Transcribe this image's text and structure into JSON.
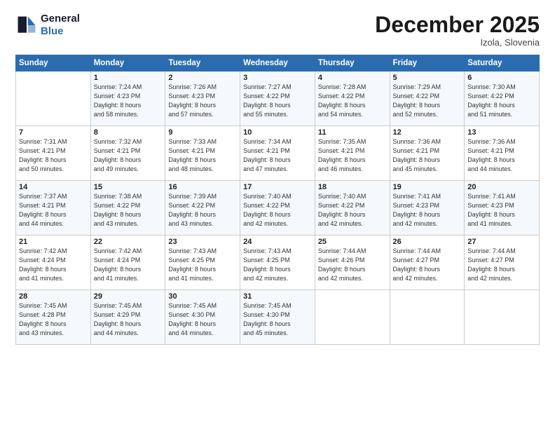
{
  "header": {
    "logo_line1": "General",
    "logo_line2": "Blue",
    "month": "December 2025",
    "location": "Izola, Slovenia"
  },
  "days_of_week": [
    "Sunday",
    "Monday",
    "Tuesday",
    "Wednesday",
    "Thursday",
    "Friday",
    "Saturday"
  ],
  "weeks": [
    [
      {
        "day": "",
        "content": ""
      },
      {
        "day": "1",
        "content": "Sunrise: 7:24 AM\nSunset: 4:23 PM\nDaylight: 8 hours\nand 58 minutes."
      },
      {
        "day": "2",
        "content": "Sunrise: 7:26 AM\nSunset: 4:23 PM\nDaylight: 8 hours\nand 57 minutes."
      },
      {
        "day": "3",
        "content": "Sunrise: 7:27 AM\nSunset: 4:22 PM\nDaylight: 8 hours\nand 55 minutes."
      },
      {
        "day": "4",
        "content": "Sunrise: 7:28 AM\nSunset: 4:22 PM\nDaylight: 8 hours\nand 54 minutes."
      },
      {
        "day": "5",
        "content": "Sunrise: 7:29 AM\nSunset: 4:22 PM\nDaylight: 8 hours\nand 52 minutes."
      },
      {
        "day": "6",
        "content": "Sunrise: 7:30 AM\nSunset: 4:22 PM\nDaylight: 8 hours\nand 51 minutes."
      }
    ],
    [
      {
        "day": "7",
        "content": "Sunrise: 7:31 AM\nSunset: 4:21 PM\nDaylight: 8 hours\nand 50 minutes."
      },
      {
        "day": "8",
        "content": "Sunrise: 7:32 AM\nSunset: 4:21 PM\nDaylight: 8 hours\nand 49 minutes."
      },
      {
        "day": "9",
        "content": "Sunrise: 7:33 AM\nSunset: 4:21 PM\nDaylight: 8 hours\nand 48 minutes."
      },
      {
        "day": "10",
        "content": "Sunrise: 7:34 AM\nSunset: 4:21 PM\nDaylight: 8 hours\nand 47 minutes."
      },
      {
        "day": "11",
        "content": "Sunrise: 7:35 AM\nSunset: 4:21 PM\nDaylight: 8 hours\nand 46 minutes."
      },
      {
        "day": "12",
        "content": "Sunrise: 7:36 AM\nSunset: 4:21 PM\nDaylight: 8 hours\nand 45 minutes."
      },
      {
        "day": "13",
        "content": "Sunrise: 7:36 AM\nSunset: 4:21 PM\nDaylight: 8 hours\nand 44 minutes."
      }
    ],
    [
      {
        "day": "14",
        "content": "Sunrise: 7:37 AM\nSunset: 4:21 PM\nDaylight: 8 hours\nand 44 minutes."
      },
      {
        "day": "15",
        "content": "Sunrise: 7:38 AM\nSunset: 4:22 PM\nDaylight: 8 hours\nand 43 minutes."
      },
      {
        "day": "16",
        "content": "Sunrise: 7:39 AM\nSunset: 4:22 PM\nDaylight: 8 hours\nand 43 minutes."
      },
      {
        "day": "17",
        "content": "Sunrise: 7:40 AM\nSunset: 4:22 PM\nDaylight: 8 hours\nand 42 minutes."
      },
      {
        "day": "18",
        "content": "Sunrise: 7:40 AM\nSunset: 4:22 PM\nDaylight: 8 hours\nand 42 minutes."
      },
      {
        "day": "19",
        "content": "Sunrise: 7:41 AM\nSunset: 4:23 PM\nDaylight: 8 hours\nand 42 minutes."
      },
      {
        "day": "20",
        "content": "Sunrise: 7:41 AM\nSunset: 4:23 PM\nDaylight: 8 hours\nand 41 minutes."
      }
    ],
    [
      {
        "day": "21",
        "content": "Sunrise: 7:42 AM\nSunset: 4:24 PM\nDaylight: 8 hours\nand 41 minutes."
      },
      {
        "day": "22",
        "content": "Sunrise: 7:42 AM\nSunset: 4:24 PM\nDaylight: 8 hours\nand 41 minutes."
      },
      {
        "day": "23",
        "content": "Sunrise: 7:43 AM\nSunset: 4:25 PM\nDaylight: 8 hours\nand 41 minutes."
      },
      {
        "day": "24",
        "content": "Sunrise: 7:43 AM\nSunset: 4:25 PM\nDaylight: 8 hours\nand 42 minutes."
      },
      {
        "day": "25",
        "content": "Sunrise: 7:44 AM\nSunset: 4:26 PM\nDaylight: 8 hours\nand 42 minutes."
      },
      {
        "day": "26",
        "content": "Sunrise: 7:44 AM\nSunset: 4:27 PM\nDaylight: 8 hours\nand 42 minutes."
      },
      {
        "day": "27",
        "content": "Sunrise: 7:44 AM\nSunset: 4:27 PM\nDaylight: 8 hours\nand 42 minutes."
      }
    ],
    [
      {
        "day": "28",
        "content": "Sunrise: 7:45 AM\nSunset: 4:28 PM\nDaylight: 8 hours\nand 43 minutes."
      },
      {
        "day": "29",
        "content": "Sunrise: 7:45 AM\nSunset: 4:29 PM\nDaylight: 8 hours\nand 44 minutes."
      },
      {
        "day": "30",
        "content": "Sunrise: 7:45 AM\nSunset: 4:30 PM\nDaylight: 8 hours\nand 44 minutes."
      },
      {
        "day": "31",
        "content": "Sunrise: 7:45 AM\nSunset: 4:30 PM\nDaylight: 8 hours\nand 45 minutes."
      },
      {
        "day": "",
        "content": ""
      },
      {
        "day": "",
        "content": ""
      },
      {
        "day": "",
        "content": ""
      }
    ]
  ]
}
